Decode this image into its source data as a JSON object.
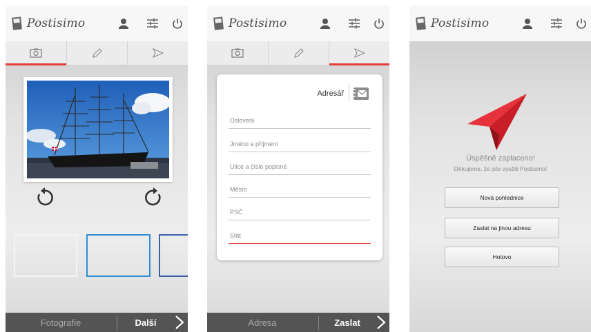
{
  "app": {
    "logo_text": "Postisimo"
  },
  "icons": {
    "user": "user-icon",
    "settings": "sliders-icon",
    "power": "power-icon",
    "tab_photo": "camera-icon",
    "tab_edit": "pencil-icon",
    "tab_send": "send-icon"
  },
  "colors": {
    "accent": "#e53a3a",
    "selected_thumb": "#2f8fd6",
    "bottom_bar": "#545454"
  },
  "screen1": {
    "active_tab": "photo",
    "bottom": {
      "left_label": "Fotografie",
      "right_label": "Další"
    }
  },
  "screen2": {
    "active_tab": "send",
    "address_book_label": "Adresář",
    "fields": [
      {
        "placeholder": "Oslovení",
        "value": ""
      },
      {
        "placeholder": "Jméno a příjmení",
        "value": ""
      },
      {
        "placeholder": "Ulice a číslo popisné",
        "value": ""
      },
      {
        "placeholder": "Město",
        "value": ""
      },
      {
        "placeholder": "PSČ",
        "value": ""
      },
      {
        "placeholder": "Stát",
        "value": ""
      }
    ],
    "bottom": {
      "left_label": "Adresa",
      "right_label": "Zaslat"
    }
  },
  "screen3": {
    "success_title": "Úspěšně zaplaceno!",
    "thanks": "Děkujeme, že jste využili Postisimo!",
    "buttons": [
      "Nová pohlednice",
      "Zaslat na jinou adresu",
      "Hotovo"
    ]
  }
}
